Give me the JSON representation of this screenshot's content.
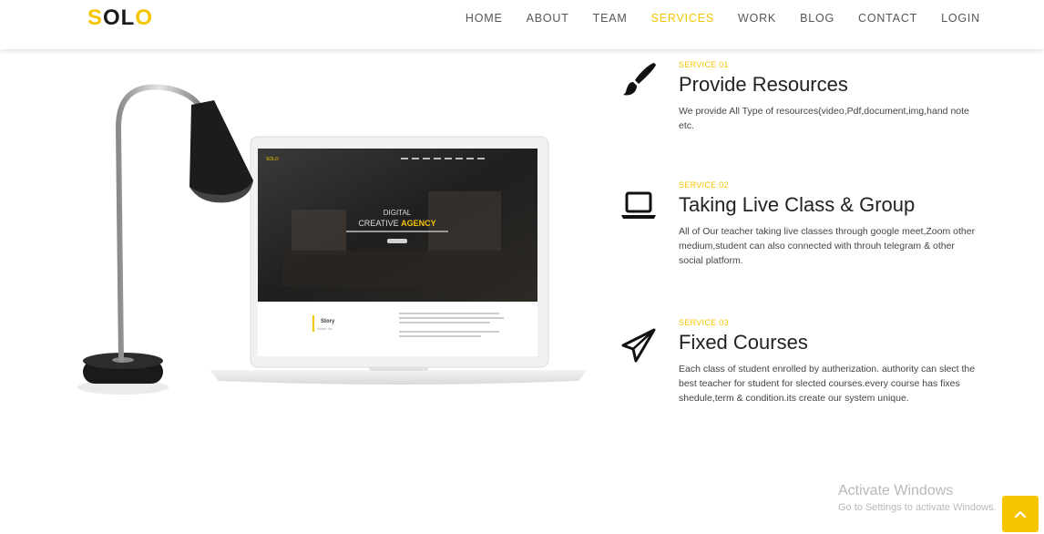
{
  "header": {
    "logo": {
      "part1": "S",
      "part2": "OL",
      "part3": "O"
    },
    "nav": [
      {
        "label": "HOME",
        "active": false
      },
      {
        "label": "ABOUT",
        "active": false
      },
      {
        "label": "TEAM",
        "active": false
      },
      {
        "label": "SERVICES",
        "active": true
      },
      {
        "label": "WORK",
        "active": false
      },
      {
        "label": "BLOG",
        "active": false
      },
      {
        "label": "CONTACT",
        "active": false
      },
      {
        "label": "LOGIN",
        "active": false
      }
    ]
  },
  "illustration": {
    "screen_logo": "SOLO",
    "screen_headline_1": "DIGITAL",
    "screen_headline_2a": "CREATIVE ",
    "screen_headline_2b": "AGENCY",
    "screen_story": "Story",
    "screen_story_sub": "About Us"
  },
  "services": [
    {
      "number": "SERVICE 01",
      "title": "Provide Resources",
      "description": "We provide All Type of resources(video,Pdf,document,img,hand note etc.",
      "icon": "brush-icon"
    },
    {
      "number": "SERVICE 02",
      "title": "Taking Live Class & Group",
      "description": "All of Our teacher taking live classes through google meet,Zoom other medium,student can also connected with throuh telegram & other social platform.",
      "icon": "laptop-icon"
    },
    {
      "number": "SERVICE 03",
      "title": "Fixed Courses",
      "description": "Each class of student enrolled by autherization. authority can slect the best teacher for student for slected courses.every course has fixes shedule,term & condition.its create our system unique.",
      "icon": "paper-plane-icon"
    }
  ],
  "watermark": {
    "title": "Activate Windows",
    "subtitle": "Go to Settings to activate Windows."
  },
  "colors": {
    "accent": "#f6c500",
    "text": "#222222"
  }
}
